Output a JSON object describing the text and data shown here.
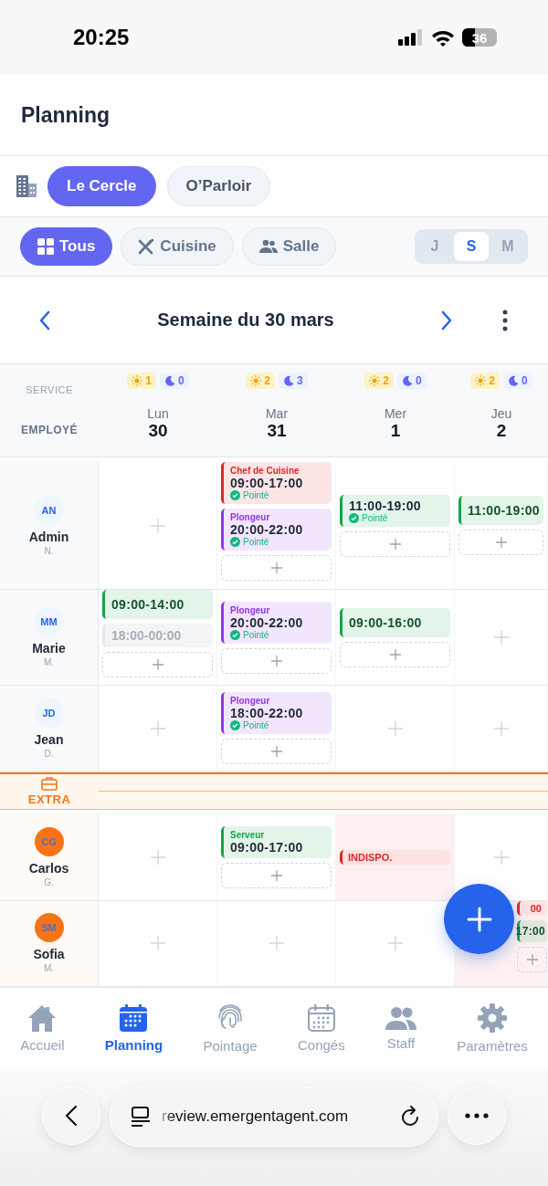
{
  "status_bar": {
    "time": "20:25",
    "battery": "36"
  },
  "header": {
    "title": "Planning"
  },
  "sites": [
    {
      "label": "Le Cercle",
      "selected": true
    },
    {
      "label": "O’Parloir",
      "selected": false
    }
  ],
  "filters": [
    {
      "label": "Tous",
      "kind": "all",
      "selected": true
    },
    {
      "label": "Cuisine",
      "kind": "kitchen",
      "selected": false
    },
    {
      "label": "Salle",
      "kind": "room",
      "selected": false
    }
  ],
  "view_modes": [
    {
      "label": "J",
      "selected": false
    },
    {
      "label": "S",
      "selected": true
    },
    {
      "label": "M",
      "selected": false
    }
  ],
  "week_nav": {
    "title": "Semaine du 30 mars"
  },
  "grid": {
    "service_label": "SERVICE",
    "employee_label": "EMPLOYÉ",
    "days": [
      {
        "name": "Lun",
        "number": "30",
        "day_count": "1",
        "night_count": "0"
      },
      {
        "name": "Mar",
        "number": "31",
        "day_count": "2",
        "night_count": "3"
      },
      {
        "name": "Mer",
        "number": "1",
        "day_count": "2",
        "night_count": "0"
      },
      {
        "name": "Jeu",
        "number": "2",
        "day_count": "2",
        "night_count": "0"
      }
    ],
    "groups": [
      {
        "kind": "staff",
        "employees": [
          {
            "initials": "AN",
            "name": "Admin",
            "short": "N.",
            "cells": [
              {
                "add": true
              },
              {
                "items": [
                  {
                    "kind": "shift",
                    "role": "Chef de Cuisine",
                    "time": "09:00-17:00",
                    "status": "Pointé",
                    "color": "#dc2626"
                  },
                  {
                    "kind": "shift",
                    "role": "Plongeur",
                    "time": "20:00-22:00",
                    "status": "Pointé",
                    "color": "#9333ea"
                  }
                ],
                "add": true
              },
              {
                "items": [
                  {
                    "kind": "shift",
                    "time": "11:00-19:00",
                    "status": "Pointé",
                    "color": "#16a34a"
                  }
                ],
                "add": true
              },
              {
                "items": [
                  {
                    "kind": "shift",
                    "time": "11:00-19:00",
                    "color": "#16a34a"
                  }
                ],
                "add": true
              }
            ]
          },
          {
            "initials": "MM",
            "name": "Marie",
            "short": "M.",
            "cells": [
              {
                "items": [
                  {
                    "kind": "shift",
                    "time": "09:00-14:00",
                    "color": "#16a34a"
                  },
                  {
                    "kind": "ghost",
                    "time": "18:00-00:00"
                  }
                ],
                "add": true
              },
              {
                "items": [
                  {
                    "kind": "shift",
                    "role": "Plongeur",
                    "time": "20:00-22:00",
                    "status": "Pointé",
                    "color": "#9333ea"
                  }
                ],
                "add": true
              },
              {
                "items": [
                  {
                    "kind": "shift",
                    "time": "09:00-16:00",
                    "color": "#16a34a"
                  }
                ],
                "add": true
              },
              {
                "add": true
              }
            ]
          },
          {
            "initials": "JD",
            "name": "Jean",
            "short": "D.",
            "cells": [
              {
                "add": true
              },
              {
                "items": [
                  {
                    "kind": "shift",
                    "role": "Plongeur",
                    "time": "18:00-22:00",
                    "status": "Pointé",
                    "color": "#9333ea"
                  }
                ],
                "add": true
              },
              {
                "add": true
              },
              {
                "add": true
              }
            ]
          }
        ]
      },
      {
        "kind": "extra",
        "label": "EXTRA",
        "employees": [
          {
            "initials": "CG",
            "name": "Carlos",
            "short": "G.",
            "cells": [
              {
                "add": true
              },
              {
                "items": [
                  {
                    "kind": "shift",
                    "role": "Serveur",
                    "time": "09:00-17:00",
                    "color": "#16a34a"
                  }
                ],
                "add": true
              },
              {
                "unavailable": true,
                "items": [
                  {
                    "kind": "unavailable",
                    "label": "INDISPO."
                  }
                ]
              },
              {
                "add": true
              }
            ]
          },
          {
            "initials": "SM",
            "name": "Sofia",
            "short": "M.",
            "cells": [
              {
                "add": true
              },
              {
                "add": true
              },
              {
                "add": true
              },
              {
                "unavailable": true,
                "items": [
                  {
                    "kind": "unavailable",
                    "label": "00"
                  },
                  {
                    "kind": "shift",
                    "time": "17:00",
                    "color": "#16a34a"
                  }
                ],
                "add": true
              }
            ]
          }
        ]
      }
    ]
  },
  "nav": [
    {
      "label": "Accueil",
      "kind": "home",
      "selected": false
    },
    {
      "label": "Planning",
      "kind": "calendar",
      "selected": true
    },
    {
      "label": "Pointage",
      "kind": "fingerprint",
      "selected": false
    },
    {
      "label": "Congés",
      "kind": "leave",
      "selected": false
    },
    {
      "label": "Staff",
      "kind": "staff",
      "selected": false
    },
    {
      "label": "Paramètres",
      "kind": "settings",
      "selected": false
    }
  ],
  "browser": {
    "url": "review.emergentagent.com"
  }
}
